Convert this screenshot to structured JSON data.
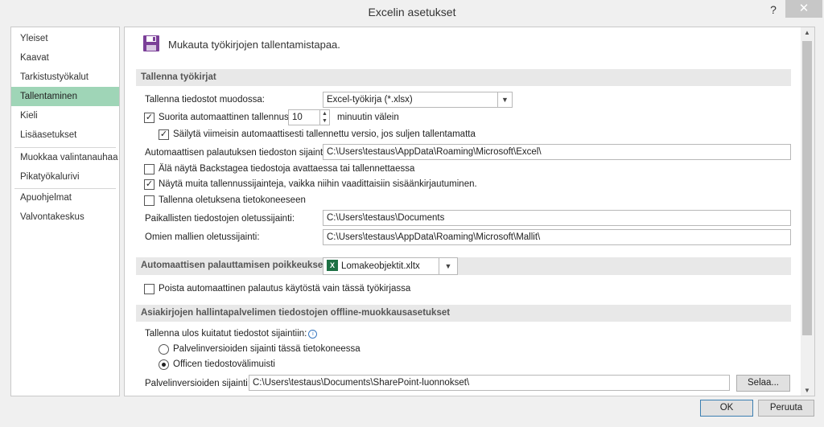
{
  "window": {
    "title": "Excelin asetukset",
    "help": "?",
    "close": "✕"
  },
  "sidebar": {
    "items": [
      {
        "label": "Yleiset"
      },
      {
        "label": "Kaavat"
      },
      {
        "label": "Tarkistustyökalut"
      },
      {
        "label": "Tallentaminen"
      },
      {
        "label": "Kieli"
      },
      {
        "label": "Lisäasetukset"
      },
      {
        "label": "Muokkaa valintanauhaa"
      },
      {
        "label": "Pikatyökalurivi"
      },
      {
        "label": "Apuohjelmat"
      },
      {
        "label": "Valvontakeskus"
      }
    ],
    "active_index": 3
  },
  "header": {
    "text": "Mukauta työkirjojen tallentamistapaa.",
    "icon": "floppy-disk-icon"
  },
  "save_workbooks": {
    "section_title": "Tallenna työkirjat",
    "format_label": "Tallenna tiedostot muodossa:",
    "format_value": "Excel-työkirja (*.xlsx)",
    "autorecover_label": "Suorita automaattinen tallennus",
    "autorecover_checked": true,
    "autorecover_minutes": "10",
    "minutes_suffix": "minuutin välein",
    "keep_last_label": "Säilytä viimeisin automaattisesti tallennettu versio, jos suljen tallentamatta",
    "keep_last_checked": true,
    "autorecover_location_label": "Automaattisen palautuksen tiedoston sijainti:",
    "autorecover_location_value": "C:\\Users\\testaus\\AppData\\Roaming\\Microsoft\\Excel\\",
    "dont_show_backstage_label": "Älä näytä Backstagea tiedostoja avattaessa tai tallennettaessa",
    "dont_show_backstage_checked": false,
    "show_additional_label": "Näytä muita tallennussijainteja, vaikka niihin vaadittaisiin sisäänkirjautuminen.",
    "show_additional_checked": true,
    "save_to_computer_label": "Tallenna oletuksena tietokoneeseen",
    "save_to_computer_checked": false,
    "local_default_label": "Paikallisten tiedostojen oletussijainti:",
    "local_default_value": "C:\\Users\\testaus\\Documents",
    "templates_label": "Omien mallien oletussijainti:",
    "templates_value": "C:\\Users\\testaus\\AppData\\Roaming\\Microsoft\\Mallit\\"
  },
  "autorecover_exceptions": {
    "section_title": "Automaattisen palauttamisen poikkeukset:",
    "workbook_value": "Lomakeobjektit.xltx",
    "workbook_icon": "X",
    "disable_label": "Poista automaattinen palautus käytöstä vain tässä työkirjassa",
    "disable_checked": false
  },
  "offline_editing": {
    "section_title": "Asiakirjojen hallintapalvelimen tiedostojen offline-muokkausasetukset",
    "save_checked_out_label": "Tallenna ulos kuitatut tiedostot sijaintiin:",
    "info_icon": "i",
    "option_server_label": "Palvelinversioiden sijainti tässä tietokoneessa",
    "option_cache_label": "Officen tiedostovälimuisti",
    "selected_option": "cache",
    "server_drafts_label": "Palvelinversioiden sijainti:",
    "server_drafts_value": "C:\\Users\\testaus\\Documents\\SharePoint-luonnokset\\",
    "browse_label": "Selaa..."
  },
  "footer": {
    "ok_label": "OK",
    "cancel_label": "Peruuta"
  }
}
